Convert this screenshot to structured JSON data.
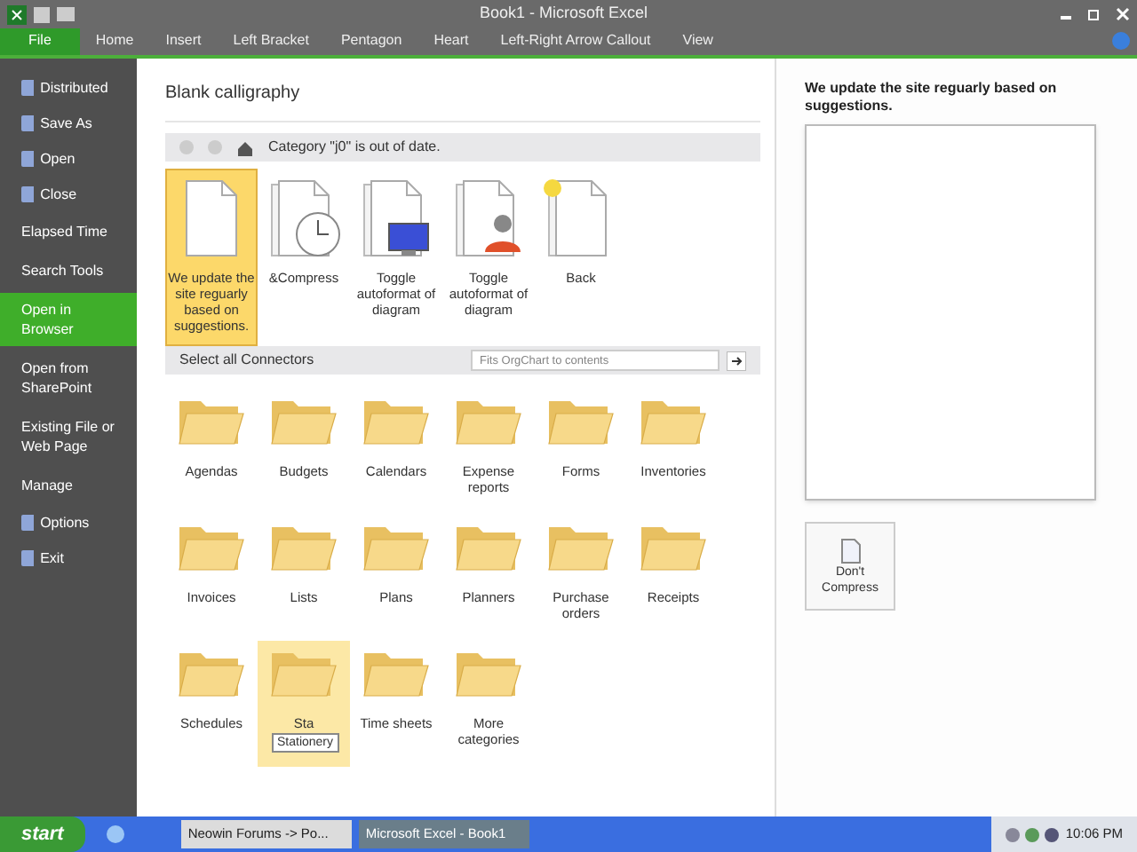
{
  "window": {
    "title": "Book1  -  Microsoft Excel"
  },
  "tabs": [
    {
      "label": "File",
      "selected": true
    },
    {
      "label": "Home",
      "selected": false
    },
    {
      "label": "Insert",
      "selected": false
    },
    {
      "label": "Left Bracket",
      "selected": false
    },
    {
      "label": "Pentagon",
      "selected": false
    },
    {
      "label": "Heart",
      "selected": false
    },
    {
      "label": "Left-Right Arrow Callout",
      "selected": false
    },
    {
      "label": "View",
      "selected": false
    }
  ],
  "sidebar": {
    "items": [
      {
        "label": "Distributed",
        "kind": "command",
        "selected": false
      },
      {
        "label": "Save As",
        "kind": "command",
        "selected": false
      },
      {
        "label": "Open",
        "kind": "command",
        "selected": false
      },
      {
        "label": "Close",
        "kind": "command",
        "selected": false
      },
      {
        "label": "Elapsed Time",
        "kind": "place",
        "selected": false
      },
      {
        "label": "Search Tools",
        "kind": "place",
        "selected": false
      },
      {
        "label": "Open in Browser",
        "kind": "place",
        "selected": true
      },
      {
        "label": "Open from SharePoint",
        "kind": "place",
        "selected": false
      },
      {
        "label": "Existing File or Web Page",
        "kind": "place",
        "selected": false
      },
      {
        "label": "Manage",
        "kind": "place",
        "selected": false
      },
      {
        "label": "Options",
        "kind": "command",
        "selected": false
      },
      {
        "label": "Exit",
        "kind": "command",
        "selected": false
      }
    ]
  },
  "main": {
    "title": "Blank calligraphy",
    "nav_message": "Category \"j0\" is out of date.",
    "templates": [
      {
        "label": "We update the site reguarly based on suggestions.",
        "kind": "blank",
        "selected": true
      },
      {
        "label": "&Compress",
        "kind": "clock",
        "selected": false
      },
      {
        "label": "Toggle autoformat of diagram",
        "kind": "monitor",
        "selected": false
      },
      {
        "label": "Toggle autoformat of diagram",
        "kind": "person",
        "selected": false
      },
      {
        "label": "Back",
        "kind": "sun",
        "selected": false
      }
    ],
    "section_title": "Select all Connectors",
    "search": {
      "placeholder": "Fits OrgChart to contents"
    },
    "folders": [
      {
        "label": "Agendas",
        "selected": false
      },
      {
        "label": "Budgets",
        "selected": false
      },
      {
        "label": "Calendars",
        "selected": false
      },
      {
        "label": "Expense reports",
        "selected": false
      },
      {
        "label": "Forms",
        "selected": false
      },
      {
        "label": "Inventories",
        "selected": false
      },
      {
        "label": "Invoices",
        "selected": false
      },
      {
        "label": "Lists",
        "selected": false
      },
      {
        "label": "Plans",
        "selected": false
      },
      {
        "label": "Planners",
        "selected": false
      },
      {
        "label": "Purchase orders",
        "selected": false
      },
      {
        "label": "Receipts",
        "selected": false
      },
      {
        "label": "Schedules",
        "selected": false
      },
      {
        "label": "Sta",
        "selected": true
      },
      {
        "label": "Time sheets",
        "selected": false
      },
      {
        "label": "More categories",
        "selected": false
      }
    ],
    "tooltip": "Stationery"
  },
  "preview": {
    "title": "We update the site reguarly based on suggestions.",
    "button": "Don't Compress"
  },
  "taskbar": {
    "start": "start",
    "tasks": [
      {
        "label": "Neowin Forums -> Po...",
        "selected": false
      },
      {
        "label": "Microsoft Excel - Book1",
        "selected": true
      }
    ],
    "clock": "10:06 PM"
  }
}
